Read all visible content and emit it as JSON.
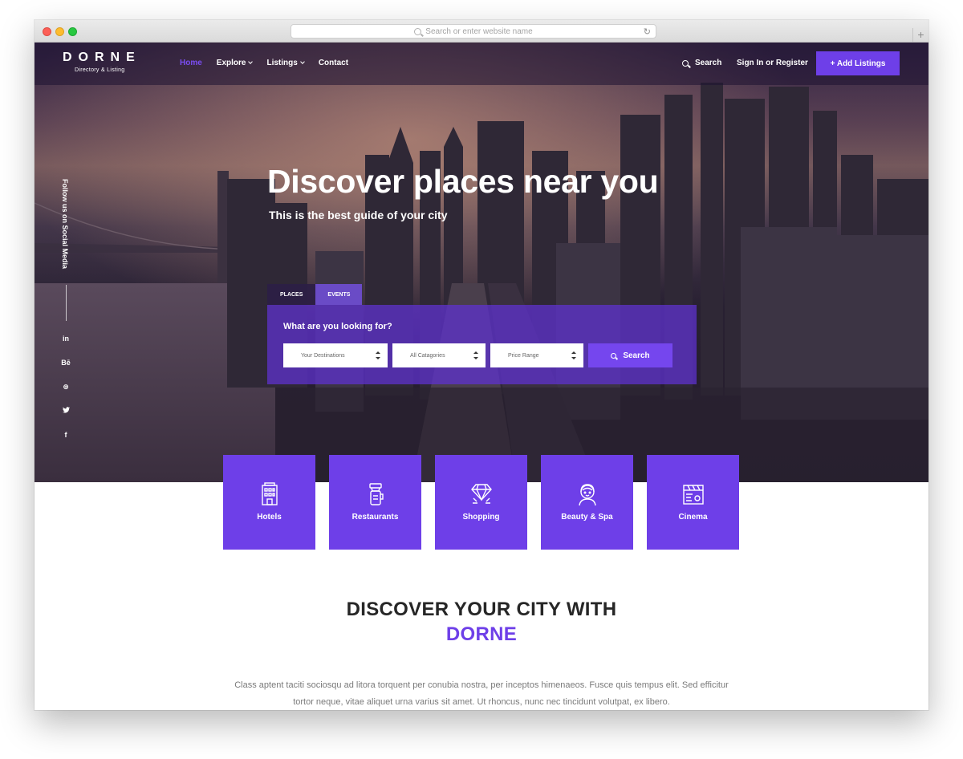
{
  "browser": {
    "url_placeholder": "Search or enter website name",
    "new_tab": "+"
  },
  "nav": {
    "brand": "DORNE",
    "tagline": "Directory & Listing",
    "items": [
      {
        "label": "Home",
        "active": true
      },
      {
        "label": "Explore",
        "dropdown": true
      },
      {
        "label": "Listings",
        "dropdown": true
      },
      {
        "label": "Contact"
      }
    ],
    "search_label": "Search",
    "signin_label": "Sign In or Register",
    "add_listing_label": "+ Add Listings"
  },
  "social": {
    "follow_text": "Follow us on Social Media",
    "links": [
      "in",
      "Bē",
      "⊛",
      "🐦",
      "f"
    ]
  },
  "hero": {
    "title": "Discover places near you",
    "subtitle": "This is the best guide of your city"
  },
  "search": {
    "tabs": [
      "PLACES",
      "EVENTS"
    ],
    "label": "What are you looking for?",
    "destinations": "Your Destinations",
    "categories": "All Catagories",
    "price": "Price Range",
    "button": "Search"
  },
  "categories": [
    {
      "label": "Hotels",
      "icon": "hotel-icon"
    },
    {
      "label": "Restaurants",
      "icon": "coffee-cup-icon"
    },
    {
      "label": "Shopping",
      "icon": "diamond-icon"
    },
    {
      "label": "Beauty & Spa",
      "icon": "woman-face-icon"
    },
    {
      "label": "Cinema",
      "icon": "clapperboard-icon"
    }
  ],
  "discover": {
    "line1": "DISCOVER YOUR CITY WITH",
    "line2": "DORNE",
    "paragraph": "Class aptent taciti sociosqu ad litora torquent per conubia nostra, per inceptos himenaeos. Fusce quis tempus elit. Sed efficitur tortor neque, vitae aliquet urna varius sit amet. Ut rhoncus, nunc nec tincidunt volutpat, ex libero."
  },
  "colors": {
    "accent": "#6e3fe8",
    "heading": "#262626",
    "text": "#7a7a7a"
  }
}
